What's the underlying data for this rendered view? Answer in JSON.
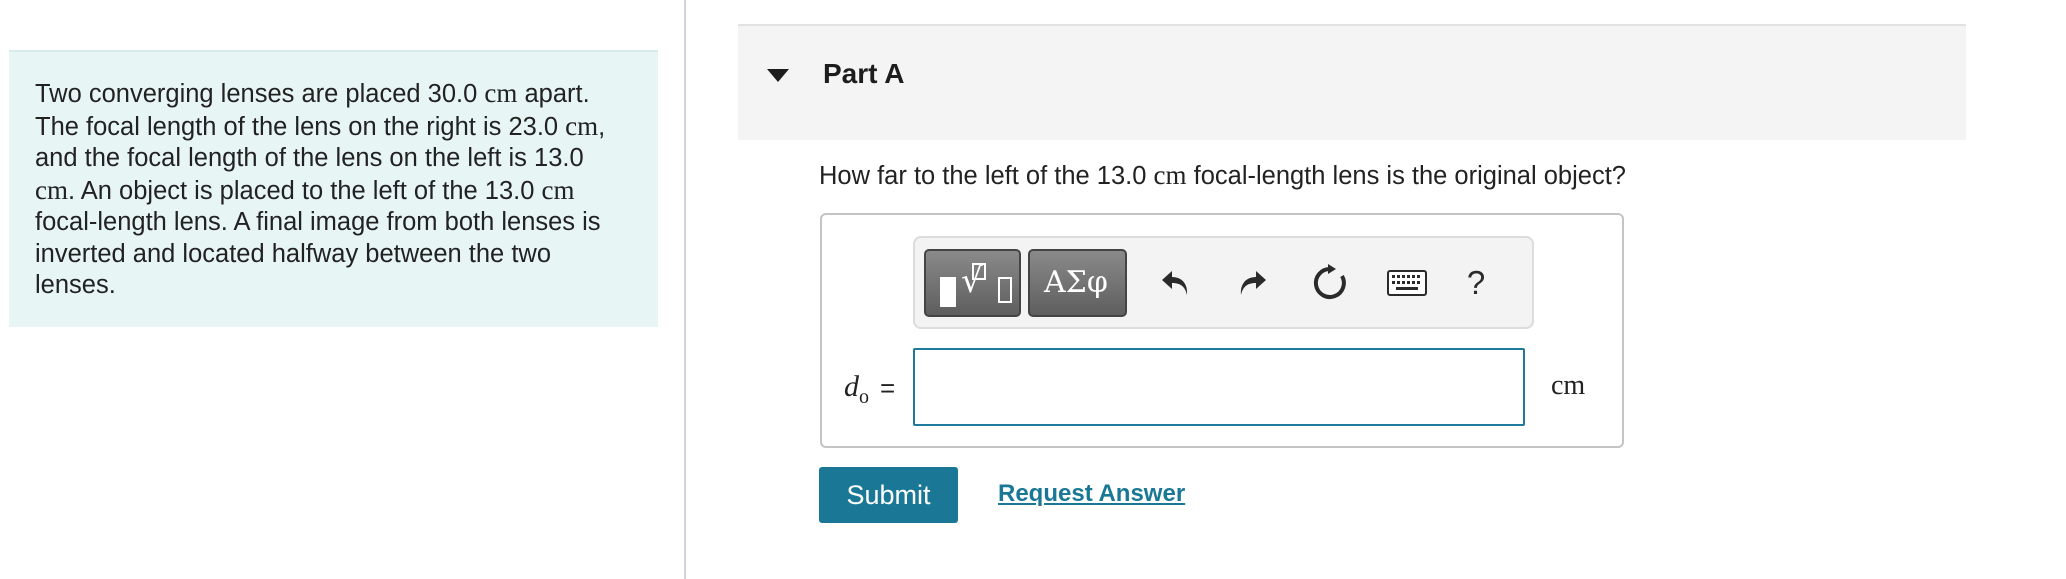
{
  "problem": {
    "part1": "Two converging lenses are placed 30.0 ",
    "unit1": "cm",
    "part2": " apart. The focal length of the lens on the right is 23.0 ",
    "unit2": "cm",
    "part3": ", and the focal length of the lens on the left is 13.0 ",
    "unit3": "cm",
    "part4": ". An object is placed to the left of the 13.0 ",
    "unit4": "cm",
    "part5": " focal-length lens. A final image from both lenses is inverted and located halfway between the two lenses."
  },
  "part": {
    "title": "Part A"
  },
  "question": {
    "before": "How far to the left of the 13.0 ",
    "unit": "cm",
    "after": " focal-length lens is the original object?"
  },
  "toolbar": {
    "symbols_label": "ΑΣφ",
    "help_label": "?",
    "icons": [
      "templates-icon",
      "symbols-icon",
      "undo-icon",
      "redo-icon",
      "reset-icon",
      "keyboard-icon",
      "help-icon"
    ]
  },
  "answer": {
    "variable": "d",
    "subscript": "o",
    "equals": "=",
    "value": "",
    "unit": "cm"
  },
  "actions": {
    "submit_label": "Submit",
    "request_label": "Request Answer"
  },
  "colors": {
    "accent": "#1a7896",
    "problem_bg": "#e7f6f5"
  }
}
